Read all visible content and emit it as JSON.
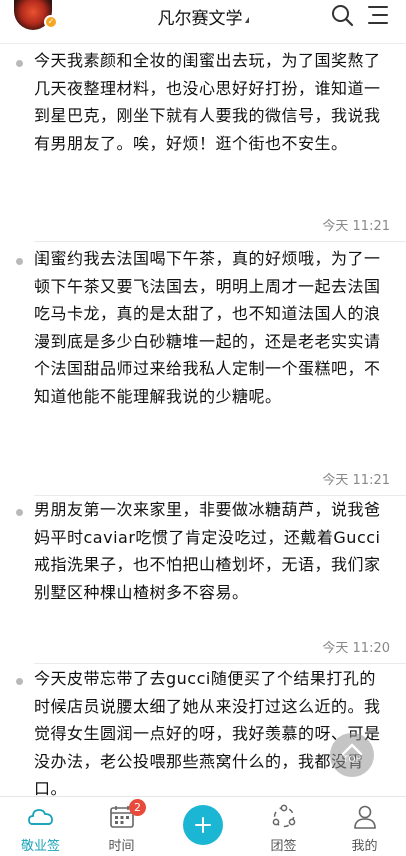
{
  "header": {
    "title": "凡尔赛文学",
    "avatar_badge": "✓",
    "icons": [
      "search-icon",
      "menu-icon"
    ]
  },
  "posts": [
    {
      "text": "今天我素颜和全妆的闺蜜出去玩，为了国奖熬了几天夜整理材料，也没心思好好打扮，谁知道一到星巴克，刚坐下就有人要我的微信号，我说我有男朋友了。唉，好烦！逛个街也不安生。",
      "time": "今天 11:21"
    },
    {
      "text": "闺蜜约我去法国喝下午茶，真的好烦哦，为了一顿下午茶又要飞法国去，明明上周才一起去法国吃马卡龙，真的是太甜了，也不知道法国人的浪漫到底是多少白砂糖堆一起的，还是老老实实请个法国甜品师过来给我私人定制一个蛋糕吧，不知道他能不能理解我说的少糖呢。",
      "time": "今天 11:21"
    },
    {
      "text": "男朋友第一次来家里，非要做冰糖葫芦，说我爸妈平时caviar吃惯了肯定没吃过，还戴着Gucci戒指洗果子，也不怕把山楂划坏，无语，我们家别墅区种棵山楂树多不容易。",
      "time": "今天 11:20"
    },
    {
      "text": "今天皮带忘带了去gucci随便买了个结果打孔的时候店员说腰太细了她从来没打过这么近的。我觉得女生圆润一点好的呀，我好羡慕的呀、可是没办法，老公投喂那些燕窝什么的，我都没胃口。",
      "time": ""
    }
  ],
  "scroll_top": {
    "label": "TOP"
  },
  "bottom_nav": {
    "items": [
      {
        "label": "敬业签",
        "icon": "cloud-icon",
        "active": true
      },
      {
        "label": "时间",
        "icon": "calendar-icon",
        "badge": "2"
      },
      {
        "label": "",
        "icon": "plus-icon"
      },
      {
        "label": "团签",
        "icon": "team-icon"
      },
      {
        "label": "我的",
        "icon": "user-icon"
      }
    ]
  },
  "colors": {
    "accent": "#1bb6d3",
    "active_text": "#1aa3b8",
    "badge": "#e84b3c",
    "time_text": "#888888"
  }
}
